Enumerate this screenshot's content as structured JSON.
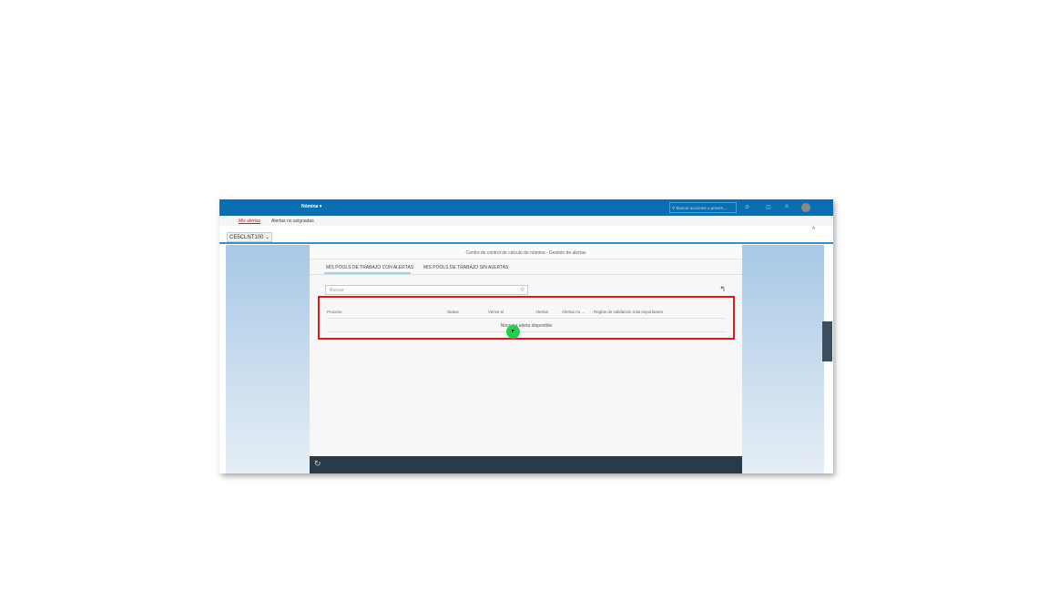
{
  "header": {
    "app_menu": "Nómina ▾",
    "search_placeholder": "Buscar acciones o presen...",
    "colors": {
      "shell": "#0a6eb0",
      "highlight": "#e3141a"
    }
  },
  "subnav": {
    "items": [
      {
        "label": "Mis alertas",
        "active": true
      },
      {
        "label": "Alertas no asignadas",
        "active": false
      }
    ]
  },
  "context": {
    "selector": "CE5CLNT100 ⌄",
    "collapse_icon": "chevron-up-icon"
  },
  "panel": {
    "title": "Centro de control de cálculo de nómina - Gestión de alertas",
    "tabs": [
      {
        "label": "MIS POOLS DE TRABAJO CON ALERTAS",
        "active": true
      },
      {
        "label": "MIS POOLS DE TRABAJO SIN ALERTAS",
        "active": false
      }
    ],
    "search_placeholder": "Buscar",
    "table": {
      "columns": [
        "Proceso",
        "Status",
        "Vence el",
        "Alertas",
        "Alertas no ...",
        "Reglas de validación más importantes"
      ],
      "empty_text": "Ninguna alerta disponible"
    }
  }
}
